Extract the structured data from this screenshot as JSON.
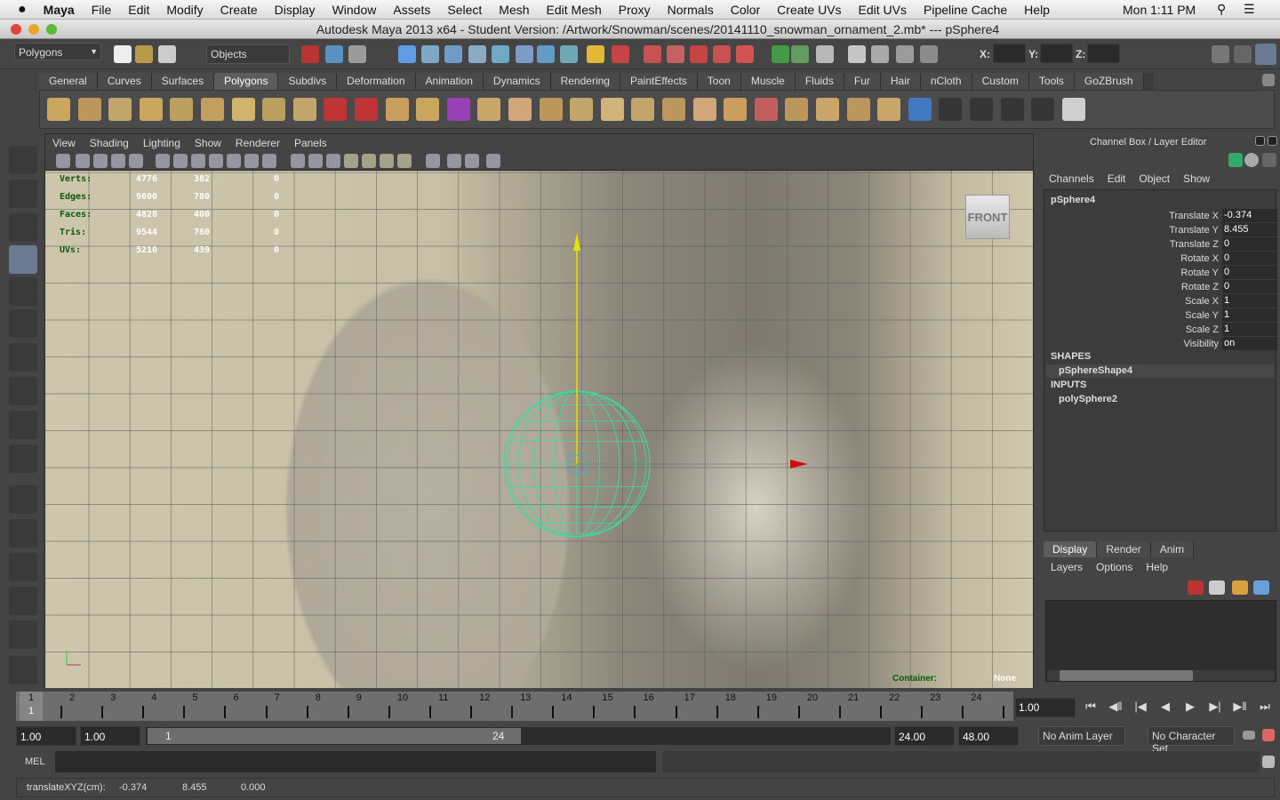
{
  "macbar": {
    "app": "Maya",
    "menus": [
      "File",
      "Edit",
      "Modify",
      "Create",
      "Display",
      "Window",
      "Assets",
      "Select",
      "Mesh",
      "Edit Mesh",
      "Proxy",
      "Normals",
      "Color",
      "Create UVs",
      "Edit UVs",
      "Pipeline Cache",
      "Help"
    ],
    "clock": "Mon 1:11 PM"
  },
  "window": {
    "title": "Autodesk Maya 2013 x64 - Student Version: /Artwork/Snowman/scenes/20141110_snowman_ornament_2.mb*  ---  pSphere4"
  },
  "status": {
    "menuset": "Polygons",
    "selection_mode": "Objects",
    "x_label": "X:",
    "y_label": "Y:",
    "z_label": "Z:"
  },
  "shelf": {
    "tabs": [
      "General",
      "Curves",
      "Surfaces",
      "Polygons",
      "Subdivs",
      "Deformation",
      "Animation",
      "Dynamics",
      "Rendering",
      "PaintEffects",
      "Toon",
      "Muscle",
      "Fluids",
      "Fur",
      "Hair",
      "nCloth",
      "Custom",
      "Tools",
      "GoZBrush"
    ],
    "active_tab": "Polygons",
    "icons": [
      "poly-sphere-icon",
      "poly-cube-icon",
      "poly-cylinder-icon",
      "poly-cone-icon",
      "poly-plane-icon",
      "poly-torus-icon",
      "poly-pyramid-icon",
      "poly-pipe-icon",
      "poly-soccer-ball-icon",
      "combine-icon",
      "separate-icon",
      "extract-icon",
      "boolean-icon",
      "smooth-icon",
      "mirror-icon",
      "append-polygon-icon",
      "split-polygon-icon",
      "insert-edge-loop-icon",
      "offset-edge-loop-icon",
      "extrude-icon",
      "bridge-icon",
      "bevel-icon",
      "wedge-icon",
      "poke-icon",
      "merge-icon",
      "collapse-icon",
      "triangulate-icon",
      "quadrangulate-icon",
      "sculpt-icon",
      "uv-planar-icon",
      "uv-cylindrical-icon",
      "uv-spherical-icon",
      "uv-auto-icon",
      "uv-editor-icon"
    ]
  },
  "viewport": {
    "menus": [
      "View",
      "Shading",
      "Lighting",
      "Show",
      "Renderer",
      "Panels"
    ],
    "camera_label": "FRONT",
    "container_label": "Container:",
    "container_value": "None",
    "hud": [
      {
        "label": "Verts:",
        "values": [
          "4776",
          "382",
          "0"
        ]
      },
      {
        "label": "Edges:",
        "values": [
          "9600",
          "780",
          "0"
        ]
      },
      {
        "label": "Faces:",
        "values": [
          "4828",
          "400",
          "0"
        ]
      },
      {
        "label": "Tris:",
        "values": [
          "9544",
          "760",
          "0"
        ]
      },
      {
        "label": "UVs:",
        "values": [
          "5210",
          "439",
          "0"
        ]
      }
    ]
  },
  "channelbox": {
    "title": "Channel Box / Layer Editor",
    "menus": [
      "Channels",
      "Edit",
      "Object",
      "Show"
    ],
    "object": "pSphere4",
    "channels": [
      {
        "label": "Translate X",
        "value": "-0.374"
      },
      {
        "label": "Translate Y",
        "value": "8.455"
      },
      {
        "label": "Translate Z",
        "value": "0"
      },
      {
        "label": "Rotate X",
        "value": "0"
      },
      {
        "label": "Rotate Y",
        "value": "0"
      },
      {
        "label": "Rotate Z",
        "value": "0"
      },
      {
        "label": "Scale X",
        "value": "1"
      },
      {
        "label": "Scale Y",
        "value": "1"
      },
      {
        "label": "Scale Z",
        "value": "1"
      },
      {
        "label": "Visibility",
        "value": "on"
      }
    ],
    "shapes_header": "SHAPES",
    "shape": "pSphereShape4",
    "inputs_header": "INPUTS",
    "input": "polySphere2"
  },
  "layers": {
    "tabs": [
      "Display",
      "Render",
      "Anim"
    ],
    "active_tab": "Display",
    "menus": [
      "Layers",
      "Options",
      "Help"
    ]
  },
  "timeline": {
    "frames": [
      "1",
      "2",
      "3",
      "4",
      "5",
      "6",
      "7",
      "8",
      "9",
      "10",
      "11",
      "12",
      "13",
      "14",
      "15",
      "16",
      "17",
      "18",
      "19",
      "20",
      "21",
      "22",
      "23",
      "24"
    ],
    "current_frame": "1",
    "current_time": "1.00"
  },
  "range": {
    "start": "1.00",
    "playback_start": "1.00",
    "slider_start": "1",
    "slider_end": "24",
    "playback_end": "24.00",
    "end": "48.00",
    "anim_layer": "No Anim Layer",
    "character_set": "No Character Set"
  },
  "mel": {
    "label": "MEL"
  },
  "helpline": {
    "label": "translateXYZ(cm):",
    "x": "-0.374",
    "y": "8.455",
    "z": "0.000"
  },
  "colors": {
    "wireframe": "#3fd9a0",
    "manip_y": "#e8e000",
    "manip_x": "#d01010",
    "hud_label": "#0a5a0a"
  }
}
